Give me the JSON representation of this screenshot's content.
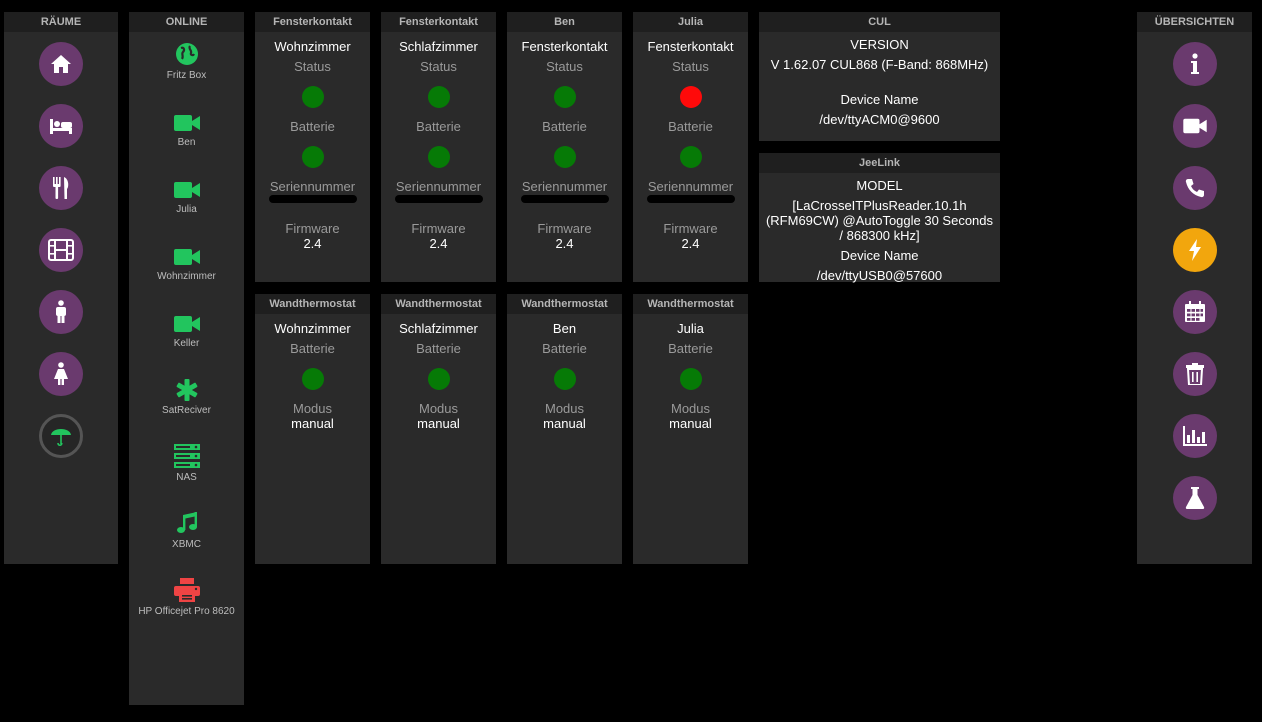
{
  "raeume": {
    "title": "RÄUME",
    "items": [
      "home-icon",
      "bed-icon",
      "dining-icon",
      "film-icon",
      "male-icon",
      "female-icon",
      "umbrella-icon"
    ]
  },
  "online": {
    "title": "ONLINE",
    "items": [
      {
        "label": "Fritz Box",
        "icon": "globe-icon",
        "color": "#22c55e"
      },
      {
        "label": "Ben",
        "icon": "video-camera-icon",
        "color": "#22c55e"
      },
      {
        "label": "Julia",
        "icon": "video-camera-icon",
        "color": "#22c55e"
      },
      {
        "label": "Wohnzimmer",
        "icon": "video-camera-icon",
        "color": "#22c55e"
      },
      {
        "label": "Keller",
        "icon": "video-camera-icon",
        "color": "#22c55e"
      },
      {
        "label": "SatReciver",
        "icon": "asterisk-icon",
        "color": "#22c55e"
      },
      {
        "label": "NAS",
        "icon": "server-icon",
        "color": "#22c55e"
      },
      {
        "label": "XBMC",
        "icon": "music-note-icon",
        "color": "#22c55e"
      },
      {
        "label": "HP Officejet Pro 8620",
        "icon": "printer-icon",
        "color": "#ef4444"
      }
    ]
  },
  "fensterkontakte": [
    {
      "title": "Fensterkontakt",
      "name": "Wohnzimmer",
      "status_label": "Status",
      "status": "ok",
      "battery_label": "Batterie",
      "battery": "ok",
      "serial_label": "Seriennummer",
      "firmware_label": "Firmware",
      "firmware": "2.4"
    },
    {
      "title": "Fensterkontakt",
      "name": "Schlafzimmer",
      "status_label": "Status",
      "status": "ok",
      "battery_label": "Batterie",
      "battery": "ok",
      "serial_label": "Seriennummer",
      "firmware_label": "Firmware",
      "firmware": "2.4"
    },
    {
      "title": "Ben",
      "name": "Fensterkontakt",
      "status_label": "Status",
      "status": "ok",
      "battery_label": "Batterie",
      "battery": "ok",
      "serial_label": "Seriennummer",
      "firmware_label": "Firmware",
      "firmware": "2.4"
    },
    {
      "title": "Julia",
      "name": "Fensterkontakt",
      "status_label": "Status",
      "status": "alarm",
      "battery_label": "Batterie",
      "battery": "ok",
      "serial_label": "Seriennummer",
      "firmware_label": "Firmware",
      "firmware": "2.4"
    }
  ],
  "thermostate": [
    {
      "title": "Wandthermostat",
      "name": "Wohnzimmer",
      "battery_label": "Batterie",
      "battery": "ok",
      "mode_label": "Modus",
      "mode": "manual"
    },
    {
      "title": "Wandthermostat",
      "name": "Schlafzimmer",
      "battery_label": "Batterie",
      "battery": "ok",
      "mode_label": "Modus",
      "mode": "manual"
    },
    {
      "title": "Wandthermostat",
      "name": "Ben",
      "battery_label": "Batterie",
      "battery": "ok",
      "mode_label": "Modus",
      "mode": "manual"
    },
    {
      "title": "Wandthermostat",
      "name": "Julia",
      "battery_label": "Batterie",
      "battery": "ok",
      "mode_label": "Modus",
      "mode": "manual"
    }
  ],
  "cul": {
    "title": "CUL",
    "version_label": "VERSION",
    "version": "V 1.62.07 CUL868 (F-Band: 868MHz)",
    "device_label": "Device Name",
    "device": "/dev/ttyACM0@9600"
  },
  "jeelink": {
    "title": "JeeLink",
    "model_label": "MODEL",
    "model": "[LaCrosseITPlusReader.10.1h (RFM69CW) @AutoToggle 30 Seconds / 868300 kHz]",
    "device_label": "Device Name",
    "device": "/dev/ttyUSB0@57600"
  },
  "uebersichten": {
    "title": "ÜBERSICHTEN",
    "items": [
      "info-icon",
      "video-camera-icon",
      "phone-icon",
      "lightning-icon",
      "calendar-icon",
      "trash-icon",
      "bar-chart-icon",
      "flask-icon"
    ],
    "active": "lightning-icon"
  },
  "colors": {
    "ok": "#067a06",
    "alarm": "#ff0a0a",
    "accent": "#6a3a6e",
    "active": "#f2a60d"
  }
}
